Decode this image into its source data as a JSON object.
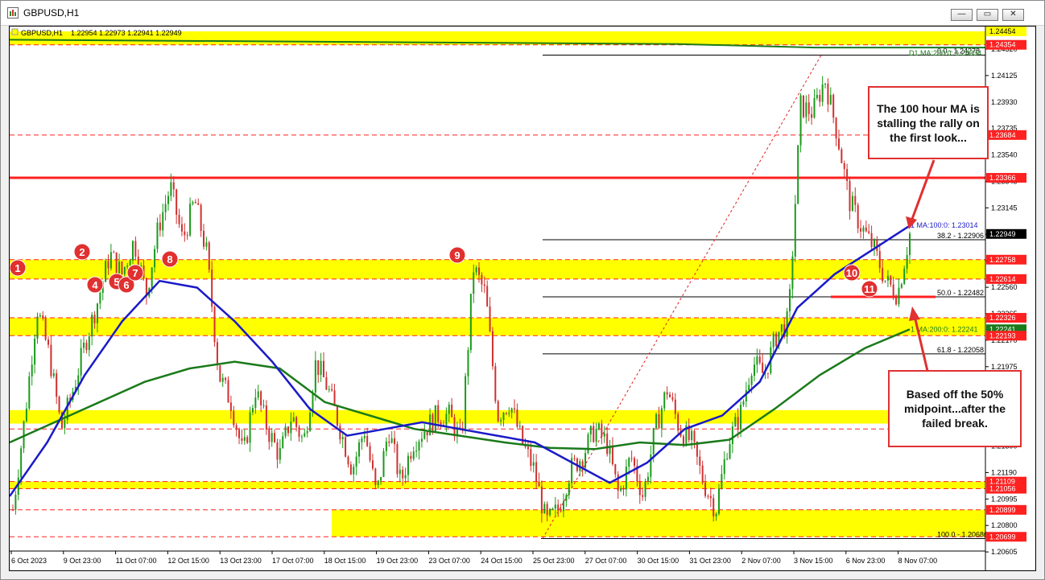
{
  "window": {
    "title": "GBPUSD,H1",
    "buttons": [
      "—",
      "▭",
      "✕"
    ]
  },
  "chart_header": {
    "symbol": "GBPUSD,H1",
    "ohlc": "1.22954 1.22973 1.22941 1.22949"
  },
  "price_axis": {
    "ticks": [
      "1.24320",
      "1.24125",
      "1.23930",
      "1.23735",
      "1.23540",
      "1.23345",
      "1.23145",
      "1.22950",
      "1.22755",
      "1.22560",
      "1.22365",
      "1.22170",
      "1.21975",
      "1.21780",
      "1.21585",
      "1.21390",
      "1.21190",
      "1.20995",
      "1.20800",
      "1.20605"
    ],
    "tags": [
      {
        "label": "1.24454",
        "bg": "#ffff00",
        "fg": "#000000"
      },
      {
        "label": "1.24354",
        "bg": "#ff2020",
        "fg": "#ffffff"
      },
      {
        "label": "1.23684",
        "bg": "#ff2020",
        "fg": "#ffffff"
      },
      {
        "label": "1.23366",
        "bg": "#ff2020",
        "fg": "#ffffff"
      },
      {
        "label": "1.22949",
        "bg": "#000000",
        "fg": "#ffffff"
      },
      {
        "label": "1.22758",
        "bg": "#ff2020",
        "fg": "#ffffff"
      },
      {
        "label": "1.22614",
        "bg": "#ff2020",
        "fg": "#ffffff"
      },
      {
        "label": "1.22326",
        "bg": "#ff2020",
        "fg": "#ffffff"
      },
      {
        "label": "1.22241",
        "bg": "#1a7a1a",
        "fg": "#ffffff"
      },
      {
        "label": "1.22193",
        "bg": "#ff2020",
        "fg": "#ffffff"
      },
      {
        "label": "1.21109",
        "bg": "#ff2020",
        "fg": "#ffffff"
      },
      {
        "label": "1.21056",
        "bg": "#ff2020",
        "fg": "#ffffff"
      },
      {
        "label": "1.20899",
        "bg": "#ff2020",
        "fg": "#ffffff"
      },
      {
        "label": "1.20699",
        "bg": "#ff2020",
        "fg": "#ffffff"
      }
    ]
  },
  "time_axis": {
    "labels": [
      "6 Oct 2023",
      "9 Oct 23:00",
      "11 Oct 07:00",
      "12 Oct 15:00",
      "13 Oct 23:00",
      "17 Oct 07:00",
      "18 Oct 15:00",
      "19 Oct 23:00",
      "23 Oct 07:00",
      "24 Oct 15:00",
      "25 Oct 23:00",
      "27 Oct 07:00",
      "30 Oct 15:00",
      "31 Oct 23:00",
      "2 Nov 07:00",
      "3 Nov 15:00",
      "6 Nov 23:00",
      "8 Nov 07:00"
    ]
  },
  "indicators": {
    "ma200_top": "D1 MA:200:0: 1.24334",
    "ma100": "1 MA:100:0: 1.23014",
    "ma200": "1 MA:200:0: 1.22241"
  },
  "fib_levels": [
    {
      "label": "0.0 - 1.24278"
    },
    {
      "label": "38.2 - 1.22906"
    },
    {
      "label": "50.0 - 1.22482"
    },
    {
      "label": "61.8 - 1.22058"
    },
    {
      "label": "100.0 - 1.20686"
    }
  ],
  "markers": [
    "1",
    "2",
    "4",
    "5",
    "6",
    "7",
    "8",
    "9",
    "10",
    "11"
  ],
  "callouts": {
    "ma100_note": "The 100 hour MA is stalling the rally on the first look...",
    "midpoint_note": "Based off the 50% midpoint...after the failed break."
  },
  "colors": {
    "zone": "#ffff00",
    "resistance": "#ff2020",
    "ma100": "#1a1ac8",
    "ma200": "#1a7a1a",
    "bull": "#1a9a1a",
    "bear": "#d03030"
  },
  "chart_data": {
    "type": "candlestick",
    "symbol": "GBPUSD",
    "timeframe": "H1",
    "y_range": [
      1.20605,
      1.24454
    ],
    "close_path": [
      1.209,
      1.216,
      1.224,
      1.2205,
      1.215,
      1.218,
      1.2215,
      1.2245,
      1.228,
      1.2265,
      1.229,
      1.225,
      1.23,
      1.233,
      1.229,
      1.232,
      1.228,
      1.219,
      1.217,
      1.213,
      1.218,
      1.215,
      1.213,
      1.216,
      1.214,
      1.22,
      1.218,
      1.215,
      1.212,
      1.215,
      1.21,
      1.215,
      1.211,
      1.214,
      1.215,
      1.216,
      1.216,
      1.214,
      1.227,
      1.225,
      1.216,
      1.217,
      1.214,
      1.212,
      1.208,
      1.209,
      1.212,
      1.213,
      1.215,
      1.214,
      1.21,
      1.213,
      1.21,
      1.215,
      1.218,
      1.215,
      1.214,
      1.211,
      1.209,
      1.214,
      1.216,
      1.22,
      1.219,
      1.222,
      1.223,
      1.239,
      1.2385,
      1.241,
      1.237,
      1.232,
      1.23,
      1.2285,
      1.226,
      1.225,
      1.2295
    ],
    "ma100_path": [
      1.21,
      1.214,
      1.219,
      1.223,
      1.226,
      1.2255,
      1.223,
      1.22,
      1.2165,
      1.2145,
      1.215,
      1.2155,
      1.215,
      1.2145,
      1.214,
      1.2125,
      1.211,
      1.2125,
      1.215,
      1.216,
      1.2185,
      1.224,
      1.2265,
      1.2283,
      1.2301
    ],
    "ma200_path": [
      1.214,
      1.2155,
      1.217,
      1.2185,
      1.2195,
      1.22,
      1.2195,
      1.217,
      1.216,
      1.215,
      1.2145,
      1.214,
      1.2136,
      1.2135,
      1.214,
      1.2138,
      1.2142,
      1.2165,
      1.219,
      1.221,
      1.2224
    ]
  }
}
